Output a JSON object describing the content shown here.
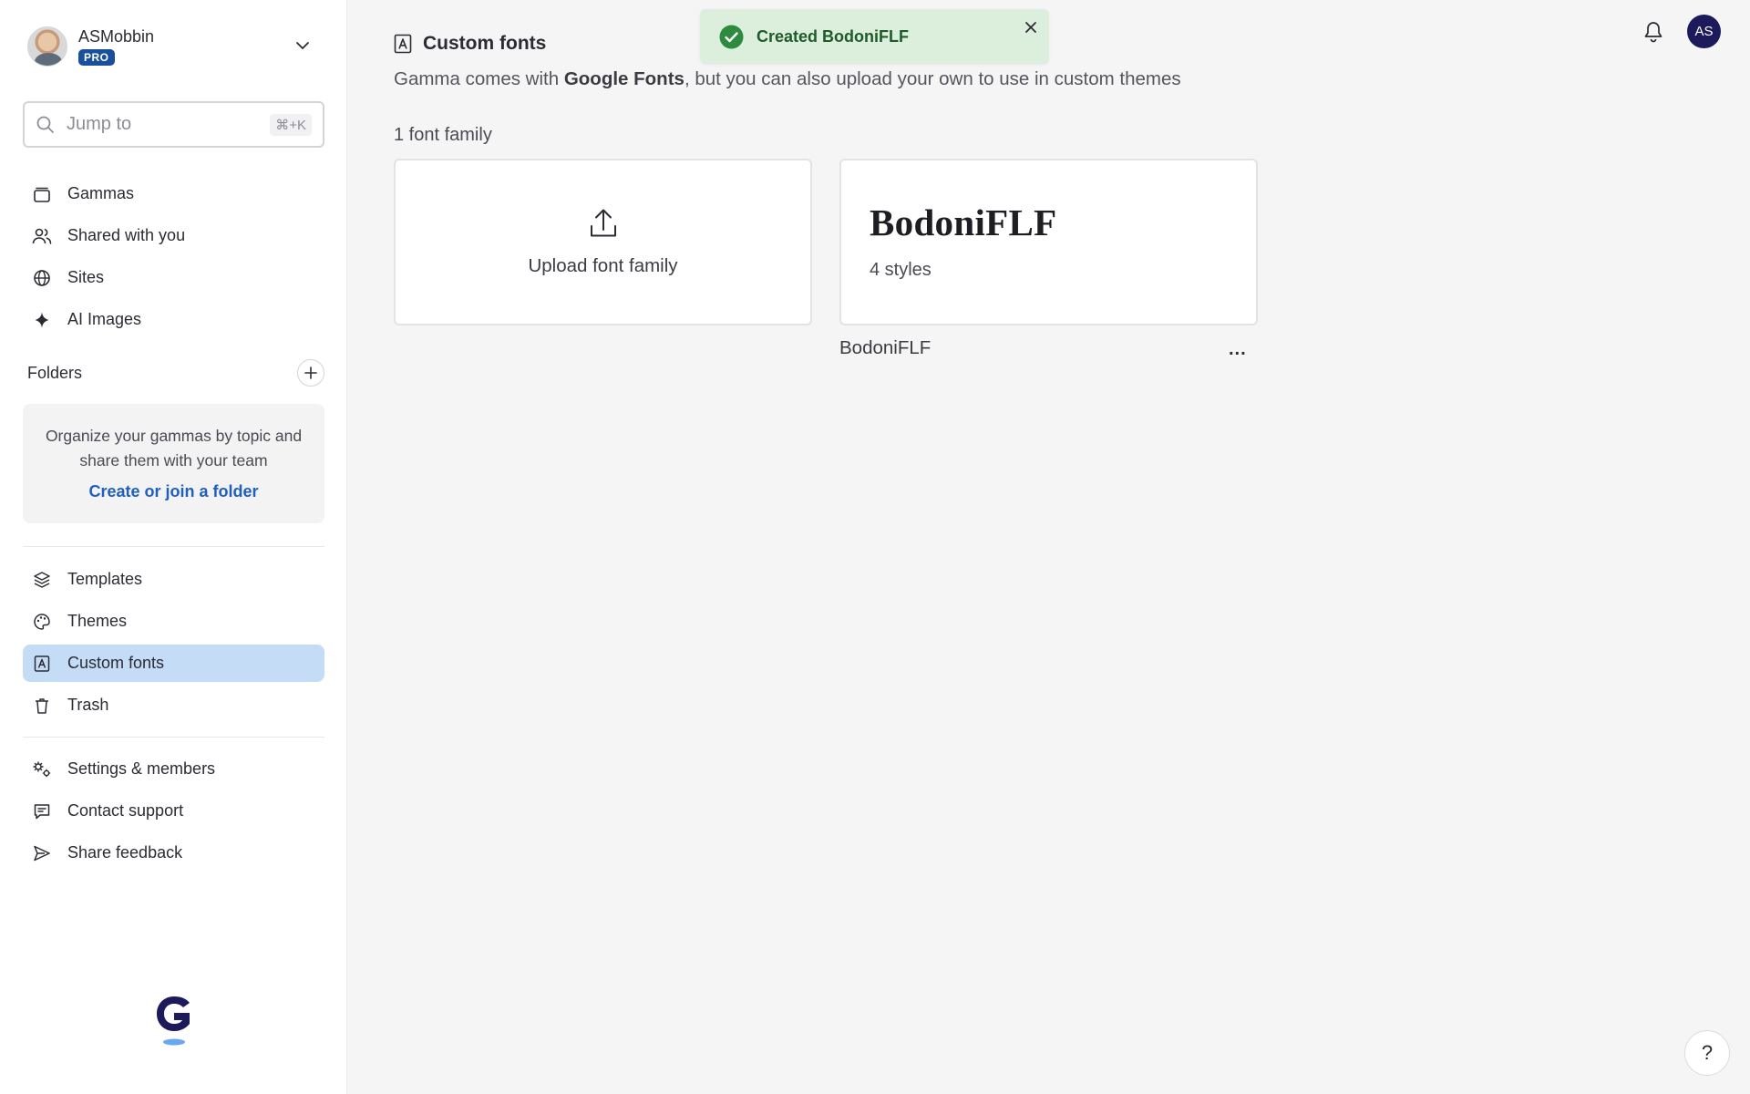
{
  "user": {
    "name": "ASMobbin",
    "badge": "PRO"
  },
  "search": {
    "placeholder": "Jump to",
    "shortcut": "⌘+K"
  },
  "nav_primary": [
    {
      "label": "Gammas",
      "icon": "stack-icon"
    },
    {
      "label": "Shared with you",
      "icon": "users-icon"
    },
    {
      "label": "Sites",
      "icon": "globe-icon"
    },
    {
      "label": "AI Images",
      "icon": "sparkle-icon"
    }
  ],
  "folders": {
    "title": "Folders",
    "description": "Organize your gammas by topic and share them with your team",
    "link": "Create or join a folder"
  },
  "nav_secondary": [
    {
      "label": "Templates",
      "icon": "layers-icon"
    },
    {
      "label": "Themes",
      "icon": "palette-icon"
    },
    {
      "label": "Custom fonts",
      "icon": "font-icon",
      "active": true
    },
    {
      "label": "Trash",
      "icon": "trash-icon"
    }
  ],
  "nav_tertiary": [
    {
      "label": "Settings & members",
      "icon": "gears-icon"
    },
    {
      "label": "Contact support",
      "icon": "chat-icon"
    },
    {
      "label": "Share feedback",
      "icon": "send-icon"
    }
  ],
  "page": {
    "title": "Custom fonts",
    "subtitle_pre": "Gamma comes with ",
    "subtitle_bold": "Google Fonts",
    "subtitle_post": ", but you can also upload your own to use in custom themes",
    "count": "1 font family"
  },
  "upload_card": {
    "label": "Upload font family"
  },
  "font_card": {
    "name": "BodoniFLF",
    "styles": "4 styles",
    "caption": "BodoniFLF",
    "menu": "..."
  },
  "toast": {
    "message": "Created BodoniFLF"
  },
  "header_right": {
    "avatar_initials": "AS"
  },
  "help": {
    "label": "?"
  },
  "colors": {
    "accent": "#1f5fbf",
    "active_nav_bg": "#c5dcf7",
    "toast_bg": "#dcefdc",
    "toast_icon": "#2e8a3e",
    "avatar_bg": "#1c1a5b"
  }
}
